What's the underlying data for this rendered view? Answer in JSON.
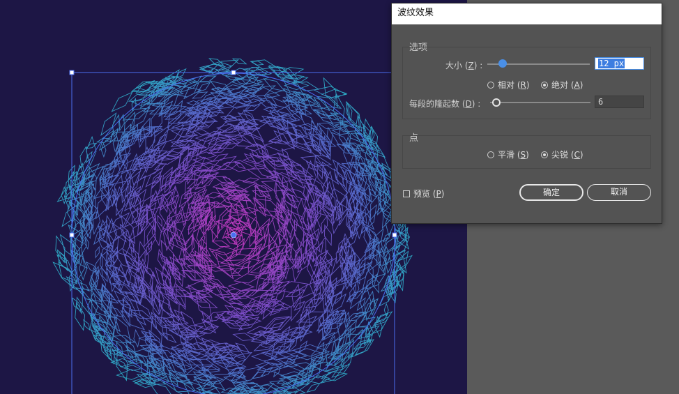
{
  "dialog": {
    "title": "波纹效果",
    "options_group_label": "选项",
    "size": {
      "label_prefix": "大小 (",
      "mnemonic": "Z",
      "label_suffix": ") :",
      "value": "12 px",
      "slider_fraction": 0.15
    },
    "size_mode": {
      "relative": {
        "prefix": "相对 (",
        "mnemonic": "R",
        "suffix": ")",
        "selected": false
      },
      "absolute": {
        "prefix": "绝对 (",
        "mnemonic": "A",
        "suffix": ")",
        "selected": true
      }
    },
    "ridges": {
      "label_prefix": "每段的隆起数 (",
      "mnemonic": "D",
      "label_suffix": ") :",
      "value": "6",
      "slider_fraction": 0.05
    },
    "points_group_label": "点",
    "points": {
      "smooth": {
        "prefix": "平滑 (",
        "mnemonic": "S",
        "suffix": ")",
        "selected": false
      },
      "corner": {
        "prefix": "尖锐 (",
        "mnemonic": "C",
        "suffix": ")",
        "selected": true
      }
    },
    "preview": {
      "prefix": "预览 (",
      "mnemonic": "P",
      "suffix": ")",
      "checked": false
    },
    "ok_label": "确定",
    "cancel_label": "取消"
  },
  "colors": {
    "artboard_bg": "#1d1645",
    "burst_center": "#e03bd0",
    "burst_mid": "#7d5de0",
    "burst_edge": "#2fc0d8",
    "selection": "#4a6ef0",
    "accent": "#4a8fe6"
  }
}
